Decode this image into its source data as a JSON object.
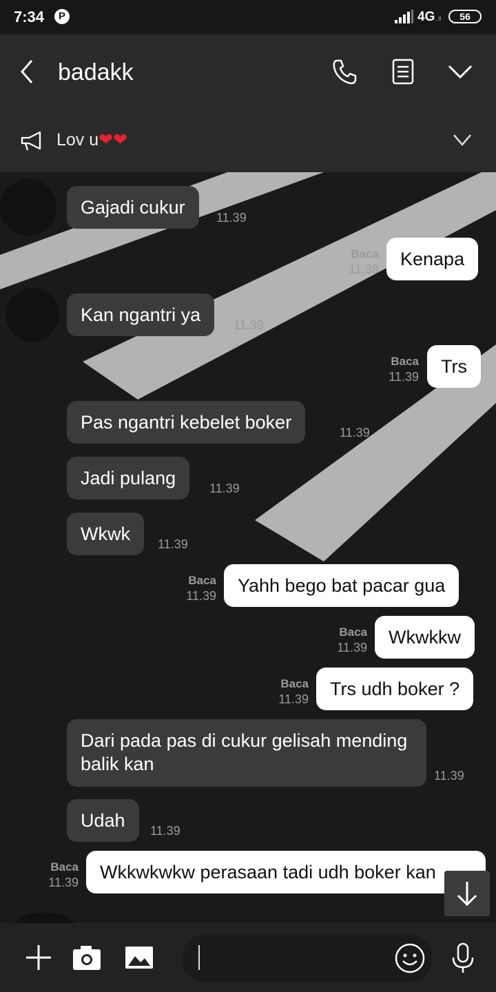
{
  "status_bar": {
    "time": "7:34",
    "pinterest_glyph": "P",
    "network": "4G",
    "network_sub": "..ll",
    "battery": "56"
  },
  "header": {
    "title": "badakk",
    "announcement_text": "Lov u",
    "announcement_hearts": "❤❤"
  },
  "messages": [
    {
      "side": "in",
      "text": "Gajadi cukur",
      "time": "11.39"
    },
    {
      "side": "out",
      "text": "Kenapa",
      "read": "Baca",
      "time": "11.39"
    },
    {
      "side": "in",
      "text": "Kan ngantri ya",
      "time": "11.39"
    },
    {
      "side": "out",
      "text": "Trs",
      "read": "Baca",
      "time": "11.39"
    },
    {
      "side": "in",
      "text": "Pas ngantri kebelet boker",
      "time": "11.39"
    },
    {
      "side": "in",
      "text": "Jadi pulang",
      "time": "11.39"
    },
    {
      "side": "in",
      "text": "Wkwk",
      "time": "11.39"
    },
    {
      "side": "out",
      "text": "Yahh bego bat pacar gua",
      "read": "Baca",
      "time": "11.39"
    },
    {
      "side": "out",
      "text": "Wkwkkw",
      "read": "Baca",
      "time": "11.39"
    },
    {
      "side": "out",
      "text": "Trs udh boker ?",
      "read": "Baca",
      "time": "11.39"
    },
    {
      "side": "in",
      "text": "Dari pada pas di cukur gelisah mending balik kan",
      "time": "11.39"
    },
    {
      "side": "in",
      "text": "Udah",
      "time": "11.39"
    },
    {
      "side": "out",
      "text": "Wkkwkwkw perasaan tadi udh boker kan",
      "read": "Baca",
      "time": "11.39"
    }
  ],
  "composer": {
    "placeholder": ""
  },
  "colors": {
    "header_bg": "#2a2a2a",
    "incoming_bubble": "#3b3b3b",
    "outgoing_bubble": "#ffffff",
    "timestamp": "#9a9a9a",
    "heart": "#e8232d"
  },
  "icons": [
    "back-icon",
    "call-icon",
    "notes-icon",
    "chevron-down-icon",
    "megaphone-icon",
    "plus-icon",
    "camera-icon",
    "image-icon",
    "emoji-icon",
    "mic-icon",
    "arrow-down-icon"
  ]
}
